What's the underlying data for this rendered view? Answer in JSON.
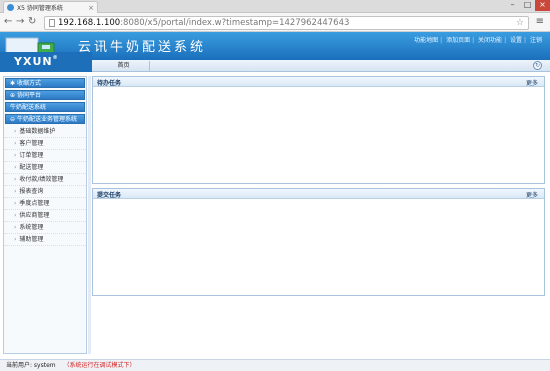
{
  "browser": {
    "tab_title": "X5 协同管理系统",
    "url_host": "192.168.1.100",
    "url_rest": ":8080/x5/portal/index.w?timestamp=1427962447643"
  },
  "app": {
    "title": "云讯牛奶配送系统",
    "logo": "YXUN",
    "logo_mark": "®",
    "top_links": [
      "功能地图",
      "添加页面",
      "关闭功能",
      "设置",
      "注销"
    ],
    "home_tab": "首页"
  },
  "sidebar": {
    "groups": [
      "收缩方式",
      "协同平台",
      "牛奶配送系统",
      "牛奶配送业务管理系统"
    ],
    "items": [
      "基础数据维护",
      "客户管理",
      "订单管理",
      "配送管理",
      "收付款/绩效管理",
      "报表查询",
      "季度点管理",
      "供应商管理",
      "系统管理",
      "辅助管理"
    ]
  },
  "panels": [
    {
      "title": "待办任务",
      "more": "更多"
    },
    {
      "title": "提交任务",
      "more": "更多"
    }
  ],
  "status": {
    "user_label": "当前用户: system",
    "mode": "（系统运行在调试模式下）"
  },
  "colors": {
    "header_blue": "#1a6fbb",
    "status_red": "#d42020"
  }
}
